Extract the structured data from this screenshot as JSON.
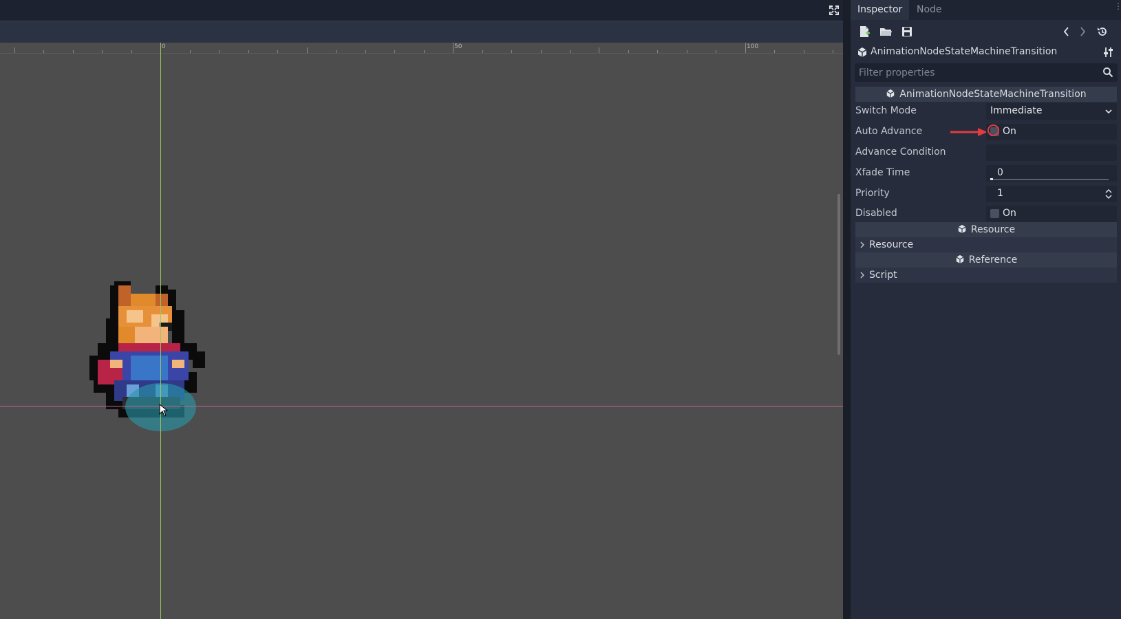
{
  "inspector": {
    "tabs": [
      {
        "label": "Inspector",
        "active": true
      },
      {
        "label": "Node",
        "active": false
      }
    ],
    "object_name": "AnimationNodeStateMachineTransition",
    "filter_placeholder": "Filter properties",
    "section_title": "AnimationNodeStateMachineTransition",
    "properties": {
      "switch_mode": {
        "label": "Switch Mode",
        "value": "Immediate"
      },
      "auto_advance": {
        "label": "Auto Advance",
        "checkbox_label": "On",
        "checked": false
      },
      "advance_condition": {
        "label": "Advance Condition",
        "value": ""
      },
      "xfade_time": {
        "label": "Xfade Time",
        "value": "0"
      },
      "priority": {
        "label": "Priority",
        "value": "1"
      },
      "disabled": {
        "label": "Disabled",
        "checkbox_label": "On",
        "checked": false
      }
    },
    "resource_section": {
      "title": "Resource",
      "item": "Resource"
    },
    "reference_section": {
      "title": "Reference",
      "item": "Script"
    }
  },
  "viewport": {
    "ruler_labels": [
      "0",
      "50",
      "100"
    ]
  },
  "colors": {
    "accent": "#9bc860",
    "annotation": "#e23b40",
    "guide_vertical": "#9bc860",
    "guide_horizontal": "#c86294"
  }
}
